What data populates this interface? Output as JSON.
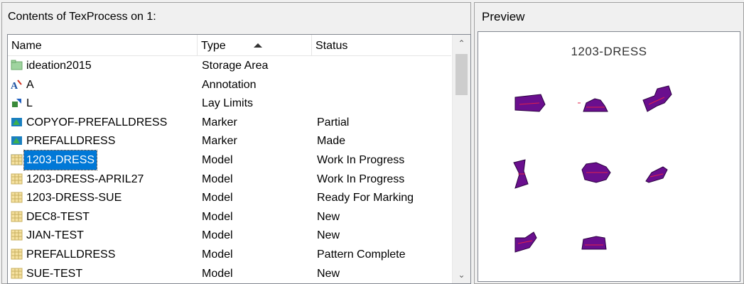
{
  "contents": {
    "title": "Contents of TexProcess on 1:",
    "columns": {
      "name": "Name",
      "type": "Type",
      "status": "Status"
    },
    "sort_column": "Type",
    "sort_direction": "ascending",
    "selected_row": "1203-DRESS",
    "rows": [
      {
        "name": "ideation2015",
        "type": "Storage Area",
        "status": "",
        "icon": "folder-icon"
      },
      {
        "name": "A",
        "type": "Annotation",
        "status": "",
        "icon": "annotation-icon"
      },
      {
        "name": "L",
        "type": "Lay Limits",
        "status": "",
        "icon": "lay-limits-icon"
      },
      {
        "name": "COPYOF-PREFALLDRESS",
        "type": "Marker",
        "status": "Partial",
        "icon": "marker-icon"
      },
      {
        "name": "PREFALLDRESS",
        "type": "Marker",
        "status": "Made",
        "icon": "marker-icon"
      },
      {
        "name": "1203-DRESS",
        "type": "Model",
        "status": "Work In Progress",
        "icon": "model-icon"
      },
      {
        "name": "1203-DRESS-APRIL27",
        "type": "Model",
        "status": "Work In Progress",
        "icon": "model-icon"
      },
      {
        "name": "1203-DRESS-SUE",
        "type": "Model",
        "status": "Ready For Marking",
        "icon": "model-icon"
      },
      {
        "name": "DEC8-TEST",
        "type": "Model",
        "status": "New",
        "icon": "model-icon"
      },
      {
        "name": "JIAN-TEST",
        "type": "Model",
        "status": "New",
        "icon": "model-icon"
      },
      {
        "name": "PREFALLDRESS",
        "type": "Model",
        "status": "Pattern Complete",
        "icon": "model-icon"
      },
      {
        "name": "SUE-TEST",
        "type": "Model",
        "status": "New",
        "icon": "model-icon"
      }
    ]
  },
  "preview": {
    "title": "Preview",
    "model_name": "1203-DRESS",
    "piece_count": 8,
    "piece_color": "#6a0f8e",
    "grainline_color": "#e0204a"
  },
  "colors": {
    "selection": "#0078d7",
    "marker_icon": "#1a7fc0",
    "folder_icon": "#8ec98e"
  }
}
